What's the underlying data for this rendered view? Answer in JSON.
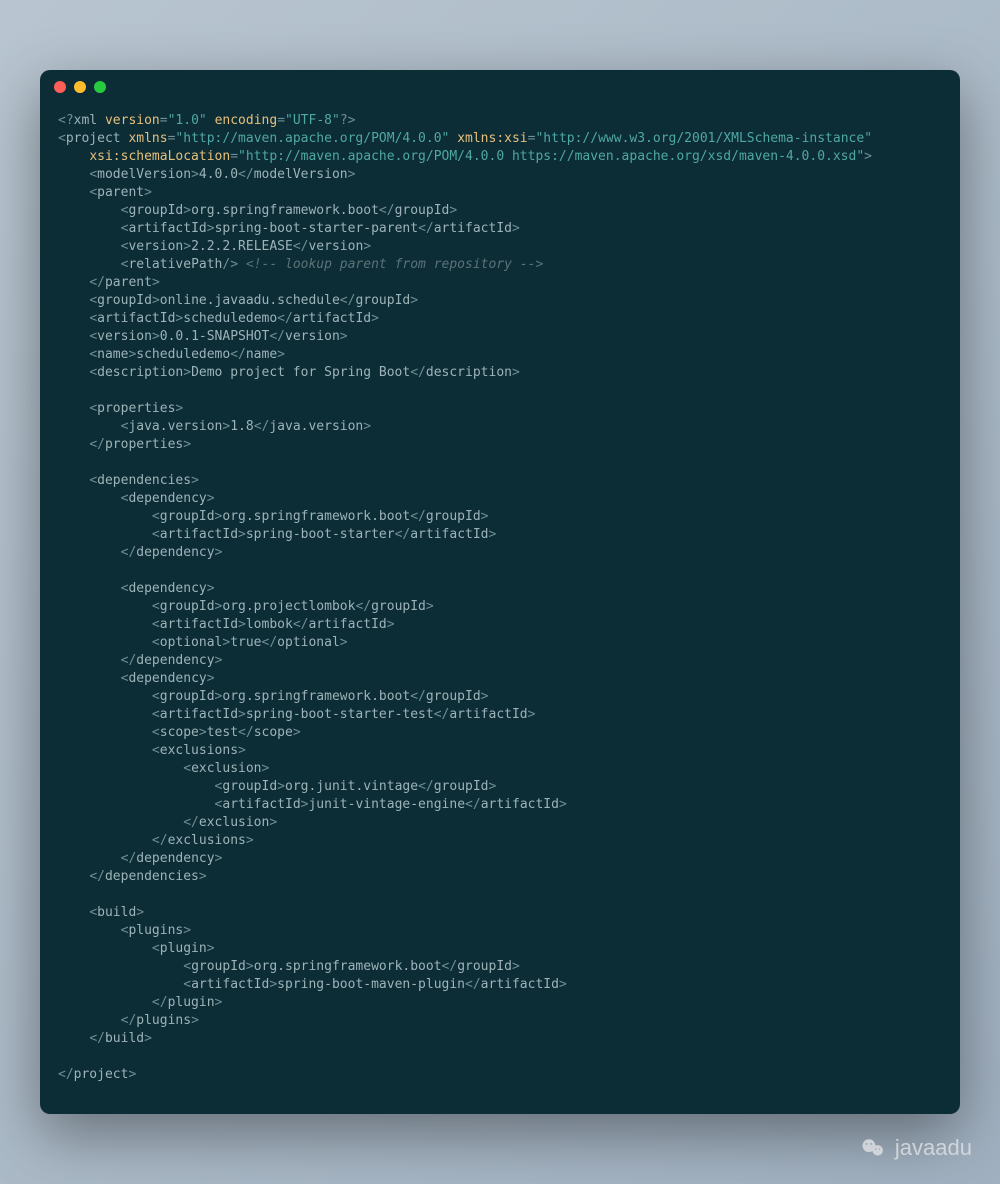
{
  "watermark": "javaadu",
  "code": {
    "xml_decl": "<?xml version=\"1.0\" encoding=\"UTF-8\"?>",
    "project_open": "project",
    "attrs": {
      "xmlns": "http://maven.apache.org/POM/4.0.0",
      "xmlns_xsi": "http://www.w3.org/2001/XMLSchema-instance",
      "schemaLocation": "http://maven.apache.org/POM/4.0.0 https://maven.apache.org/xsd/maven-4.0.0.xsd"
    },
    "modelVersion": "4.0.0",
    "parent": {
      "groupId": "org.springframework.boot",
      "artifactId": "spring-boot-starter-parent",
      "version": "2.2.2.RELEASE",
      "relativePathComment": "<!-- lookup parent from repository -->"
    },
    "groupId": "online.javaadu.schedule",
    "artifactId": "scheduledemo",
    "version": "0.0.1-SNAPSHOT",
    "name": "scheduledemo",
    "description": "Demo project for Spring Boot",
    "properties": {
      "java_version": "1.8"
    },
    "dependencies": [
      {
        "groupId": "org.springframework.boot",
        "artifactId": "spring-boot-starter"
      },
      {
        "groupId": "org.projectlombok",
        "artifactId": "lombok",
        "optional": "true"
      },
      {
        "groupId": "org.springframework.boot",
        "artifactId": "spring-boot-starter-test",
        "scope": "test",
        "exclusions": [
          {
            "groupId": "org.junit.vintage",
            "artifactId": "junit-vintage-engine"
          }
        ]
      }
    ],
    "build": {
      "plugins": [
        {
          "groupId": "org.springframework.boot",
          "artifactId": "spring-boot-maven-plugin"
        }
      ]
    }
  }
}
